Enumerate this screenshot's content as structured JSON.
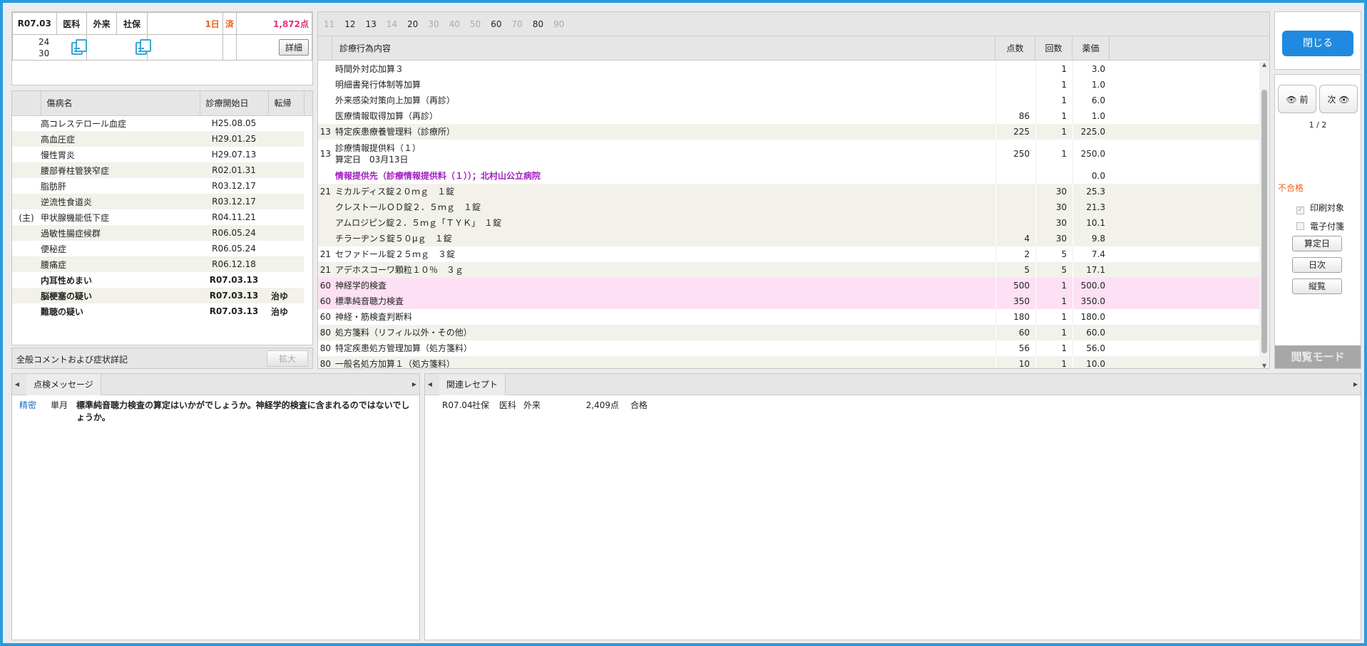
{
  "header": {
    "era_month": "R07.03",
    "dept": "医科",
    "visit_type": "外来",
    "insurance": "社保",
    "days": "1日",
    "status": "済",
    "points": "1,872点",
    "day_a": "24",
    "day_b": "30",
    "detail_button": "詳細"
  },
  "diseases": {
    "columns": [
      "傷病名",
      "診療開始日",
      "転帰"
    ],
    "rows": [
      {
        "tag": "",
        "name": "高コレステロール血症",
        "date": "H25.08.05",
        "outcome": "",
        "bold": false
      },
      {
        "tag": "",
        "name": "高血圧症",
        "date": "H29.01.25",
        "outcome": "",
        "bold": false
      },
      {
        "tag": "",
        "name": "慢性胃炎",
        "date": "H29.07.13",
        "outcome": "",
        "bold": false
      },
      {
        "tag": "",
        "name": "腰部脊柱管狭窄症",
        "date": "R02.01.31",
        "outcome": "",
        "bold": false
      },
      {
        "tag": "",
        "name": "脂肪肝",
        "date": "R03.12.17",
        "outcome": "",
        "bold": false
      },
      {
        "tag": "",
        "name": "逆流性食道炎",
        "date": "R03.12.17",
        "outcome": "",
        "bold": false
      },
      {
        "tag": "(主)",
        "name": "甲状腺機能低下症",
        "date": "R04.11.21",
        "outcome": "",
        "bold": false
      },
      {
        "tag": "",
        "name": "過敏性腸症候群",
        "date": "R06.05.24",
        "outcome": "",
        "bold": false
      },
      {
        "tag": "",
        "name": "便秘症",
        "date": "R06.05.24",
        "outcome": "",
        "bold": false
      },
      {
        "tag": "",
        "name": "腰痛症",
        "date": "R06.12.18",
        "outcome": "",
        "bold": false
      },
      {
        "tag": "",
        "name": "内耳性めまい",
        "date": "R07.03.13",
        "outcome": "",
        "bold": true
      },
      {
        "tag": "",
        "name": "脳梗塞の疑い",
        "date": "R07.03.13",
        "outcome": "治ゆ",
        "bold": true
      },
      {
        "tag": "",
        "name": "難聴の疑い",
        "date": "R07.03.13",
        "outcome": "治ゆ",
        "bold": true
      }
    ]
  },
  "comment_bar": {
    "label": "全般コメントおよび症状詳記",
    "expand_button": "拡大"
  },
  "number_tabs": [
    {
      "label": "11",
      "active": false
    },
    {
      "label": "12",
      "active": true
    },
    {
      "label": "13",
      "active": true
    },
    {
      "label": "14",
      "active": false
    },
    {
      "label": "20",
      "active": true
    },
    {
      "label": "30",
      "active": false
    },
    {
      "label": "40",
      "active": false
    },
    {
      "label": "50",
      "active": false
    },
    {
      "label": "60",
      "active": true
    },
    {
      "label": "70",
      "active": false
    },
    {
      "label": "80",
      "active": true
    },
    {
      "label": "90",
      "active": false
    }
  ],
  "treatments": {
    "columns": {
      "name": "診療行為内容",
      "points": "点数",
      "count": "回数",
      "price": "薬価"
    },
    "rows": [
      {
        "kb": "",
        "name": "時間外対応加算３",
        "name2": "",
        "pt": "",
        "cnt": "1",
        "pr": "3.0",
        "style": "",
        "purple": false
      },
      {
        "kb": "",
        "name": "明細書発行体制等加算",
        "name2": "",
        "pt": "",
        "cnt": "1",
        "pr": "1.0",
        "style": "",
        "purple": false
      },
      {
        "kb": "",
        "name": "外来感染対策向上加算（再診）",
        "name2": "",
        "pt": "",
        "cnt": "1",
        "pr": "6.0",
        "style": "",
        "purple": false
      },
      {
        "kb": "",
        "name": "医療情報取得加算（再診）",
        "name2": "",
        "pt": "86",
        "cnt": "1",
        "pr": "1.0",
        "style": "",
        "purple": false
      },
      {
        "kb": "13",
        "name": "特定疾患療養管理料（診療所）",
        "name2": "",
        "pt": "225",
        "cnt": "1",
        "pr": "225.0",
        "style": "alt",
        "purple": false
      },
      {
        "kb": "13",
        "name": "診療情報提供料（１）",
        "name2": "算定日　03月13日",
        "pt": "250",
        "cnt": "1",
        "pr": "250.0",
        "style": "tall",
        "purple": false
      },
      {
        "kb": "",
        "name": "情報提供先（診療情報提供料（１））；北村山公立病院",
        "name2": "",
        "pt": "",
        "cnt": "",
        "pr": "0.0",
        "style": "",
        "purple": true
      },
      {
        "kb": "21",
        "name": "ミカルディス錠２０ｍｇ　１錠",
        "name2": "",
        "pt": "",
        "cnt": "30",
        "pr": "25.3",
        "style": "alt",
        "purple": false
      },
      {
        "kb": "",
        "name": "クレストールＯＤ錠２．５ｍｇ　１錠",
        "name2": "",
        "pt": "",
        "cnt": "30",
        "pr": "21.3",
        "style": "alt",
        "purple": false
      },
      {
        "kb": "",
        "name": "アムロジピン錠２．５ｍｇ「ＴＹＫ」　１錠",
        "name2": "",
        "pt": "",
        "cnt": "30",
        "pr": "10.1",
        "style": "alt",
        "purple": false
      },
      {
        "kb": "",
        "name": "チラーヂンＳ錠５０μｇ　１錠",
        "name2": "",
        "pt": "4",
        "cnt": "30",
        "pr": "9.8",
        "style": "alt",
        "purple": false
      },
      {
        "kb": "21",
        "name": "セファドール錠２５ｍｇ　３錠",
        "name2": "",
        "pt": "2",
        "cnt": "5",
        "pr": "7.4",
        "style": "",
        "purple": false
      },
      {
        "kb": "21",
        "name": "アデホスコーワ顆粒１０％　３ｇ",
        "name2": "",
        "pt": "5",
        "cnt": "5",
        "pr": "17.1",
        "style": "alt",
        "purple": false
      },
      {
        "kb": "60",
        "name": "神経学的検査",
        "name2": "",
        "pt": "500",
        "cnt": "1",
        "pr": "500.0",
        "style": "pk",
        "purple": false
      },
      {
        "kb": "60",
        "name": "標準純音聴力検査",
        "name2": "",
        "pt": "350",
        "cnt": "1",
        "pr": "350.0",
        "style": "pk",
        "purple": false
      },
      {
        "kb": "60",
        "name": "神経・筋検査判断料",
        "name2": "",
        "pt": "180",
        "cnt": "1",
        "pr": "180.0",
        "style": "",
        "purple": false
      },
      {
        "kb": "80",
        "name": "処方箋料（リフィル以外・その他）",
        "name2": "",
        "pt": "60",
        "cnt": "1",
        "pr": "60.0",
        "style": "alt",
        "purple": false
      },
      {
        "kb": "80",
        "name": "特定疾患処方管理加算（処方箋料）",
        "name2": "",
        "pt": "56",
        "cnt": "1",
        "pr": "56.0",
        "style": "",
        "purple": false
      },
      {
        "kb": "80",
        "name": "一般名処方加算１（処方箋料）",
        "name2": "",
        "pt": "10",
        "cnt": "1",
        "pr": "10.0",
        "style": "alt",
        "purple": false
      }
    ]
  },
  "right_panel": {
    "close_button": "閉じる",
    "prev_button": "前",
    "next_button": "次",
    "page": "1 / 2",
    "result": "不合格",
    "print_target": "印刷対象",
    "e_attach": "電子付箋",
    "calc_day_button": "算定日",
    "daily_button": "日次",
    "overview_button": "縦覧",
    "mode_label": "閲覧モード"
  },
  "check_messages": {
    "tab_label": "点検メッセージ",
    "items": [
      {
        "level": "精密",
        "period": "単月",
        "text": "標準純音聴力検査の算定はいかがでしょうか。神経学的検査に含まれるのではないでしょうか。"
      }
    ]
  },
  "related_receipts": {
    "tab_label": "関連レセプト",
    "items": [
      {
        "month": "R07.04",
        "ins": "社保",
        "dept": "医科",
        "type": "外来",
        "points": "2,409点",
        "result": "合格"
      }
    ]
  },
  "colors": {
    "frame": "#2a9ae0",
    "close_button": "#1f8ae0",
    "days": "#e8641e",
    "points": "#e0307c",
    "highlight_row": "#fde0f3",
    "purple_text": "#a020c0",
    "fail_text": "#e8641e"
  }
}
